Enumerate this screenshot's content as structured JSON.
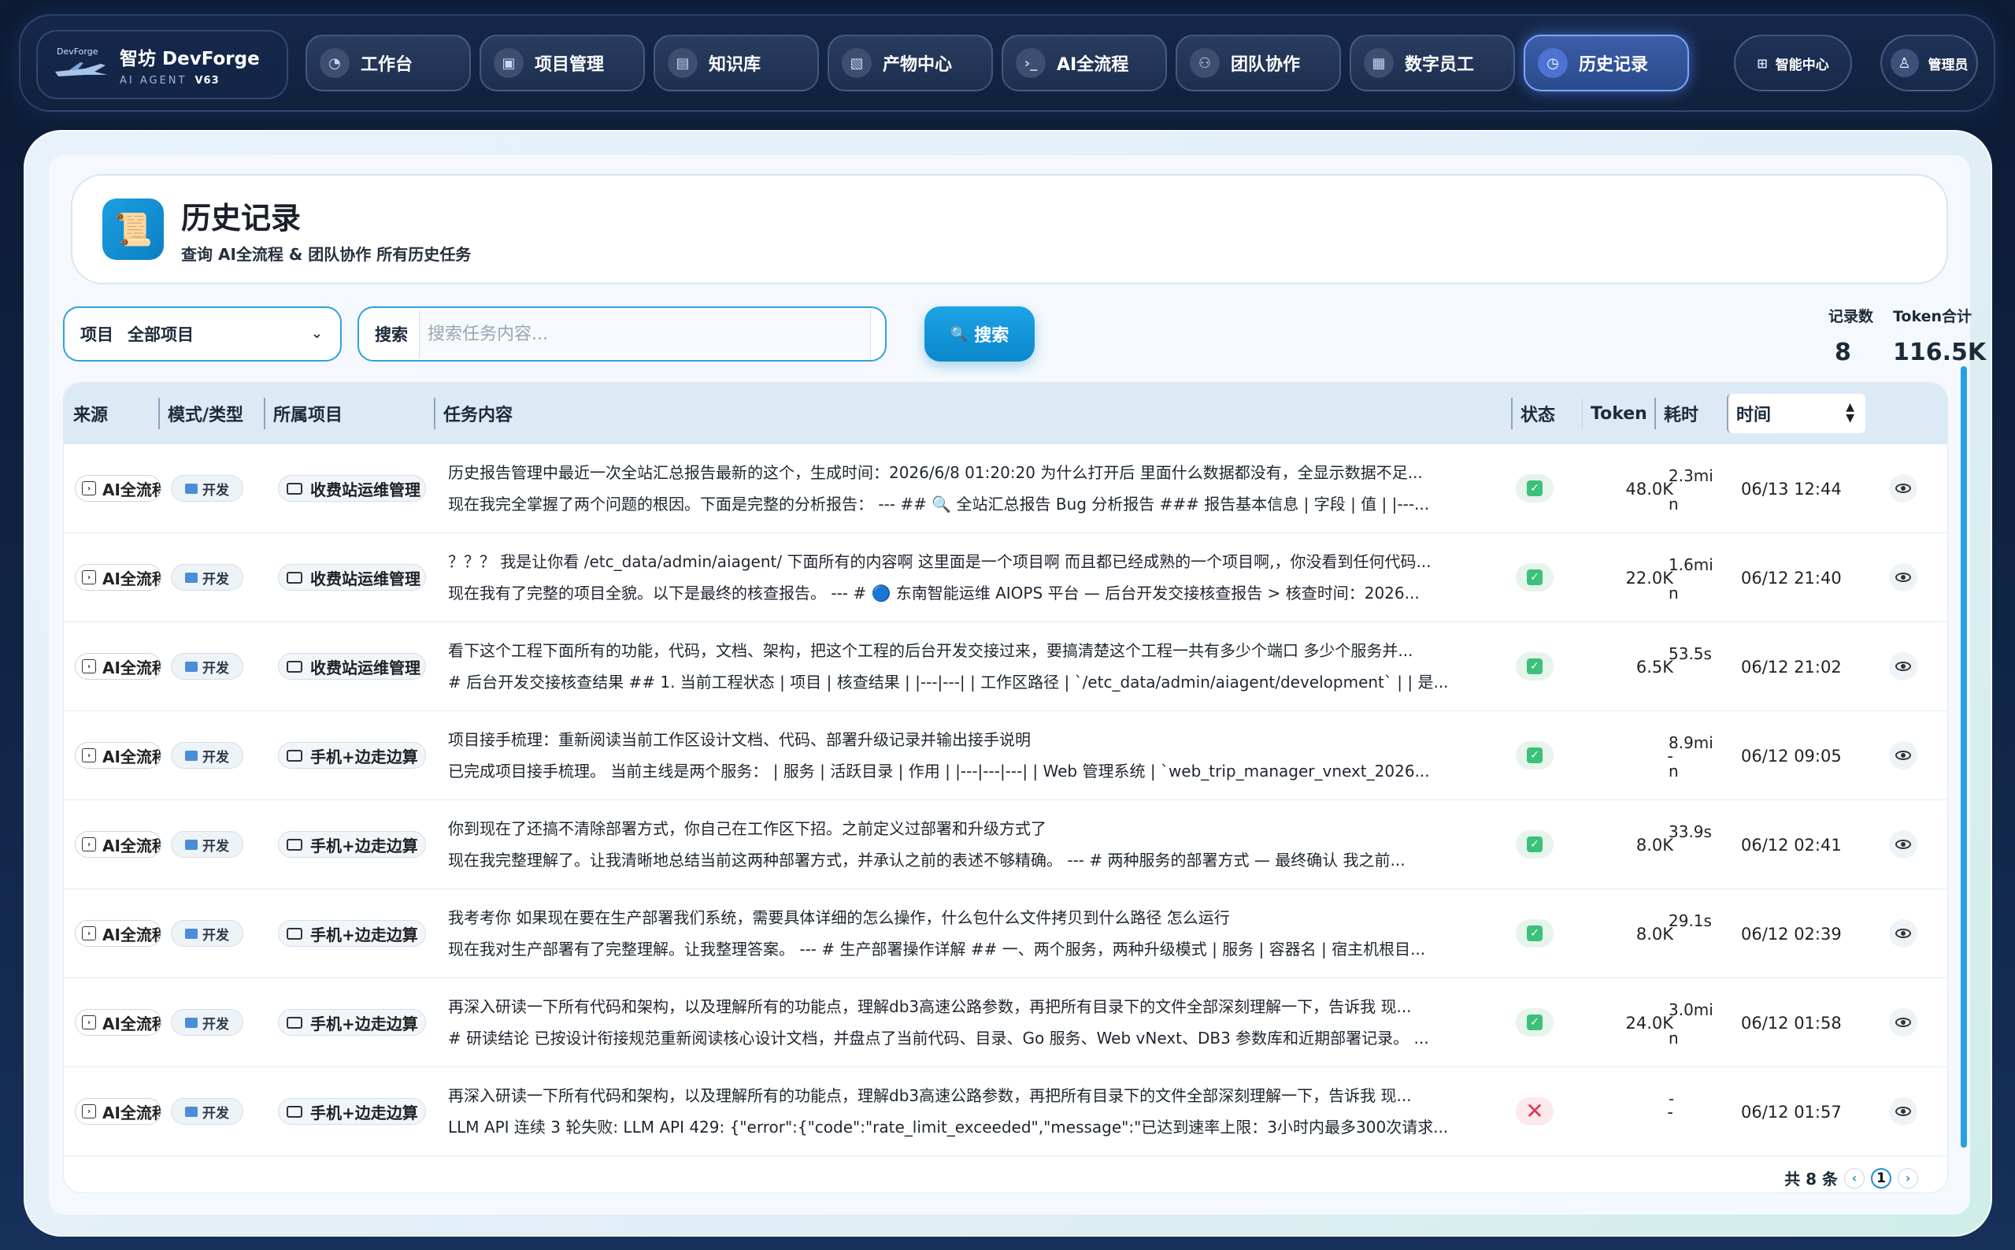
{
  "brand": {
    "small": "DevForge",
    "title": "智坊 DevForge",
    "subtitle": "AI AGENT",
    "version": "V63"
  },
  "nav": [
    {
      "label": "工作台",
      "icon": "dashboard-icon"
    },
    {
      "label": "项目管理",
      "icon": "project-icon"
    },
    {
      "label": "知识库",
      "icon": "book-icon"
    },
    {
      "label": "产物中心",
      "icon": "artifact-icon"
    },
    {
      "label": "AI全流程",
      "icon": "terminal-icon"
    },
    {
      "label": "团队协作",
      "icon": "team-icon"
    },
    {
      "label": "数字员工",
      "icon": "robot-icon"
    },
    {
      "label": "历史记录",
      "icon": "clock-icon",
      "active": true
    }
  ],
  "top_right": {
    "smart_center": "智能中心",
    "admin": "管理员"
  },
  "page": {
    "title": "历史记录",
    "subtitle": "查询 AI全流程 & 团队协作 所有历史任务"
  },
  "filters": {
    "project_label": "项目",
    "project_value": "全部项目",
    "search_label": "搜索",
    "search_placeholder": "搜索任务内容...",
    "search_button": "搜索"
  },
  "stats": {
    "records_label": "记录数",
    "records_value": "8",
    "token_label": "Token合计",
    "token_value": "116.5K"
  },
  "table": {
    "headers": {
      "source": "来源",
      "mode": "模式/类型",
      "project": "所属项目",
      "content": "任务内容",
      "status": "状态",
      "token": "Token",
      "duration": "耗时",
      "time": "时间"
    },
    "rows": [
      {
        "source": "AI全流程",
        "mode": "开发",
        "project": "收费站运维管理",
        "line1": "历史报告管理中最近一次全站汇总报告最新的这个，生成时间：2026/6/8 01:20:20 为什么打开后 里面什么数据都没有，全显示数据不足...",
        "line2": "现在我完全掌握了两个问题的根因。下面是完整的分析报告： --- ## 🔍 全站汇总报告 Bug 分析报告 ### 报告基本信息 | 字段 | 值 | |---...",
        "status": "success",
        "token": "48.0K",
        "duration": "2.3min",
        "time": "06/13 12:44"
      },
      {
        "source": "AI全流程",
        "mode": "开发",
        "project": "收费站运维管理",
        "line1": "？？？ 我是让你看 /etc_data/admin/aiagent/ 下面所有的内容啊 这里面是一个项目啊 而且都已经成熟的一个项目啊,，你没看到任何代码...",
        "line2": "现在我有了完整的项目全貌。以下是最终的核查报告。 --- # 🔵 东南智能运维 AIOPS 平台 — 后台开发交接核查报告 > 核查时间：2026...",
        "status": "success",
        "token": "22.0K",
        "duration": "1.6min",
        "time": "06/12 21:40"
      },
      {
        "source": "AI全流程",
        "mode": "开发",
        "project": "收费站运维管理",
        "line1": "看下这个工程下面所有的功能，代码，文档、架构，把这个工程的后台开发交接过来，要搞清楚这个工程一共有多少个端口 多少个服务并...",
        "line2": "# 后台开发交接核查结果 ## 1. 当前工程状态 | 项目 | 核查结果 | |---|---| | 工作区路径 | `/etc_data/admin/aiagent/development` | | 是...",
        "status": "success",
        "token": "6.5K",
        "duration": "53.5s",
        "time": "06/12 21:02"
      },
      {
        "source": "AI全流程",
        "mode": "开发",
        "project": "手机+边走边算",
        "line1": "项目接手梳理：重新阅读当前工作区设计文档、代码、部署升级记录并输出接手说明",
        "line2": "已完成项目接手梳理。 当前主线是两个服务： | 服务 | 活跃目录 | 作用 | |---|---|---| | Web 管理系统 | `web_trip_manager_vnext_2026...",
        "status": "success",
        "token": "-",
        "duration": "8.9min",
        "time": "06/12 09:05"
      },
      {
        "source": "AI全流程",
        "mode": "开发",
        "project": "手机+边走边算",
        "line1": "你到现在了还搞不清除部署方式，你自己在工作区下招。之前定义过部署和升级方式了",
        "line2": "现在我完整理解了。让我清晰地总结当前这两种部署方式，并承认之前的表述不够精确。 --- # 两种服务的部署方式 — 最终确认 我之前...",
        "status": "success",
        "token": "8.0K",
        "duration": "33.9s",
        "time": "06/12 02:41"
      },
      {
        "source": "AI全流程",
        "mode": "开发",
        "project": "手机+边走边算",
        "line1": "我考考你 如果现在要在生产部署我们系统，需要具体详细的怎么操作，什么包什么文件拷贝到什么路径 怎么运行",
        "line2": "现在我对生产部署有了完整理解。让我整理答案。 --- # 生产部署操作详解 ## 一、两个服务，两种升级模式 | 服务 | 容器名 | 宿主机根目...",
        "status": "success",
        "token": "8.0K",
        "duration": "29.1s",
        "time": "06/12 02:39"
      },
      {
        "source": "AI全流程",
        "mode": "开发",
        "project": "手机+边走边算",
        "line1": "再深入研读一下所有代码和架构，以及理解所有的功能点，理解db3高速公路参数，再把所有目录下的文件全部深刻理解一下，告诉我 现...",
        "line2": "# 研读结论 已按设计衔接规范重新阅读核心设计文档，并盘点了当前代码、目录、Go 服务、Web vNext、DB3 参数库和近期部署记录。 ...",
        "status": "success",
        "token": "24.0K",
        "duration": "3.0min",
        "time": "06/12 01:58"
      },
      {
        "source": "AI全流程",
        "mode": "开发",
        "project": "手机+边走边算",
        "line1": "再深入研读一下所有代码和架构，以及理解所有的功能点，理解db3高速公路参数，再把所有目录下的文件全部深刻理解一下，告诉我 现...",
        "line2": "LLM API 连续 3 轮失败: LLM API 429: {\"error\":{\"code\":\"rate_limit_exceeded\",\"message\":\"已达到速率上限：3小时内最多300次请求...",
        "status": "failed",
        "token": "-",
        "duration": "-",
        "time": "06/12 01:57"
      }
    ]
  },
  "pagination": {
    "total": "共 8 条",
    "current": "1"
  }
}
